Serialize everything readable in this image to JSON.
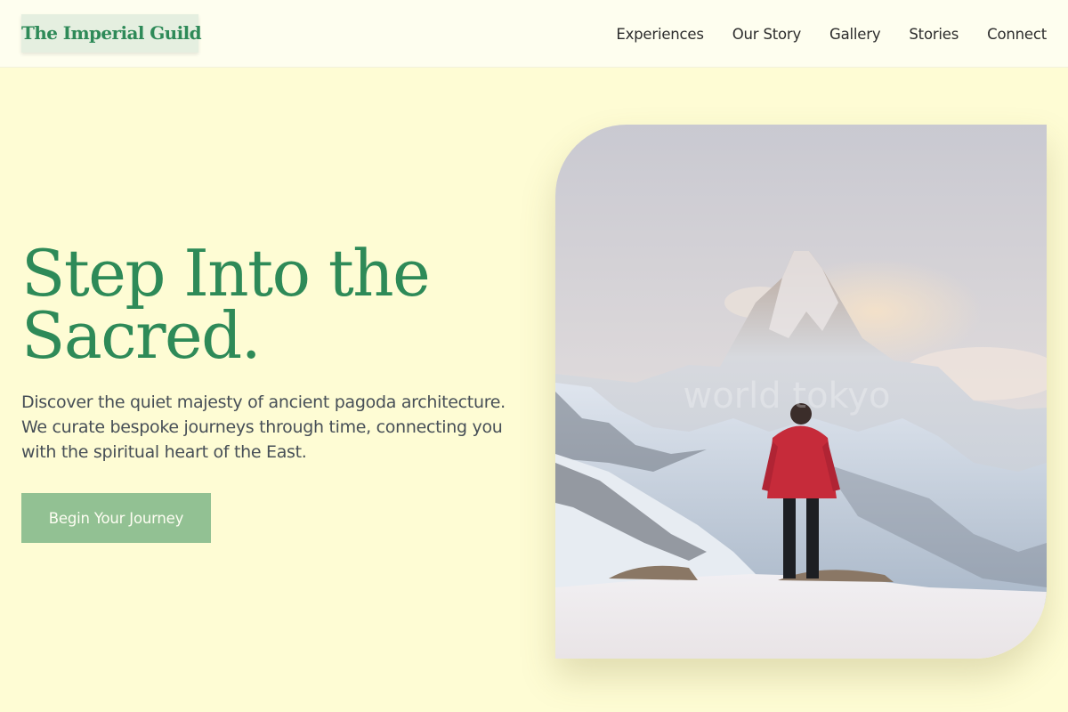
{
  "brand": {
    "name": "The Imperial Guild"
  },
  "nav": {
    "items": [
      {
        "label": "Experiences"
      },
      {
        "label": "Our Story"
      },
      {
        "label": "Gallery"
      },
      {
        "label": "Stories"
      },
      {
        "label": "Connect"
      }
    ]
  },
  "hero": {
    "headline": "Step Into the Sacred.",
    "description": "Discover the quiet majesty of ancient pagoda architecture. We curate bespoke journeys through time, connecting you with the spiritual heart of the East.",
    "cta_label": "Begin Your Journey",
    "image_watermark": "world tokyo"
  },
  "colors": {
    "background": "#fefcd4",
    "header": "#fefeef",
    "brand_green": "#2e8a58",
    "cta_green": "#92c193",
    "body_text": "#474f57"
  }
}
